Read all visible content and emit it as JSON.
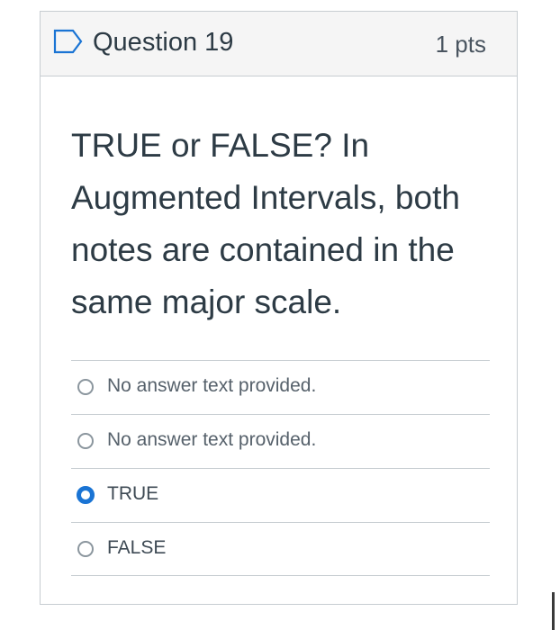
{
  "question": {
    "title": "Question 19",
    "points": "1 pts",
    "flag_icon": "flag-outline-icon",
    "text": "TRUE or FALSE?  In Augmented Intervals, both notes are contained in the same major scale."
  },
  "answers": [
    {
      "label": "No answer text provided.",
      "selected": false
    },
    {
      "label": "No answer text provided.",
      "selected": false
    },
    {
      "label": "TRUE",
      "selected": true
    },
    {
      "label": "FALSE",
      "selected": false
    }
  ],
  "colors": {
    "header_bg": "#f5f5f5",
    "border": "#c7cdd1",
    "text": "#2d3b45",
    "selected_radio": "#1a74d4"
  }
}
